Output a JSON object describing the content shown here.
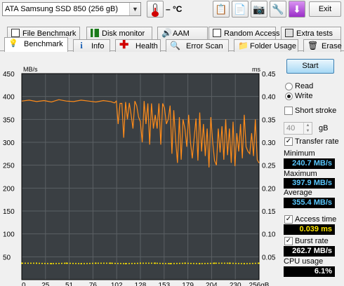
{
  "toolbar": {
    "drive_label": "ATA    Samsung SSD 850 (256 gB)",
    "temperature": "– °C",
    "exit_label": "Exit"
  },
  "tabs_row1": [
    {
      "label": "File Benchmark",
      "icon": "file-benchmark-icon"
    },
    {
      "label": "Disk monitor",
      "icon": "disk-monitor-icon"
    },
    {
      "label": "AAM",
      "icon": "speaker-icon"
    },
    {
      "label": "Random Access",
      "icon": "random-access-icon"
    },
    {
      "label": "Extra tests",
      "icon": "extra-tests-icon"
    }
  ],
  "tabs_row2": [
    {
      "label": "Benchmark",
      "icon": "benchmark-icon"
    },
    {
      "label": "Info",
      "icon": "info-icon"
    },
    {
      "label": "Health",
      "icon": "health-cross-icon"
    },
    {
      "label": "Error Scan",
      "icon": "error-scan-icon"
    },
    {
      "label": "Folder Usage",
      "icon": "folder-icon"
    },
    {
      "label": "Erase",
      "icon": "trash-icon"
    }
  ],
  "side": {
    "start_label": "Start",
    "read_label": "Read",
    "write_label": "Write",
    "short_stroke_label": "Short stroke",
    "short_stroke_value": "40",
    "short_stroke_unit": "gB",
    "transfer_rate_label": "Transfer rate",
    "minimum_label": "Minimum",
    "minimum_value": "240.7 MB/s",
    "maximum_label": "Maximum",
    "maximum_value": "397.9 MB/s",
    "average_label": "Average",
    "average_value": "355.4 MB/s",
    "access_time_label": "Access time",
    "access_time_value": "0.039 ms",
    "burst_rate_label": "Burst rate",
    "burst_rate_value": "262.7 MB/s",
    "cpu_usage_label": "CPU usage",
    "cpu_usage_value": "6.1%"
  },
  "chart_data": {
    "type": "line",
    "xlabel": "gB",
    "ylabel_left": "MB/s",
    "ylabel_right": "ms",
    "x_ticks": [
      "0",
      "25",
      "51",
      "76",
      "102",
      "128",
      "153",
      "179",
      "204",
      "230",
      "256gB"
    ],
    "y_left_ticks": [
      "450",
      "400",
      "350",
      "300",
      "250",
      "200",
      "150",
      "100",
      "50"
    ],
    "y_right_ticks": [
      "0.45",
      "0.40",
      "0.35",
      "0.30",
      "0.25",
      "0.20",
      "0.15",
      "0.10",
      "0.05"
    ],
    "xlim": [
      0,
      256
    ],
    "ylim_left": [
      0,
      450
    ],
    "ylim_right": [
      0,
      0.45
    ],
    "colors": {
      "transfer": "#ff8c1a",
      "access": "#ffe600",
      "background": "#3a3f43",
      "grid": "#5b6064"
    },
    "series": [
      {
        "name": "Transfer rate",
        "x": [
          0,
          8,
          16,
          24,
          32,
          40,
          48,
          56,
          64,
          72,
          80,
          88,
          96,
          100,
          102,
          104,
          106,
          108,
          110,
          112,
          114,
          116,
          118,
          120,
          122,
          124,
          126,
          128,
          130,
          132,
          134,
          136,
          138,
          140,
          142,
          144,
          146,
          148,
          150,
          152,
          154,
          156,
          158,
          160,
          162,
          164,
          166,
          168,
          170,
          172,
          174,
          176,
          178,
          180,
          182,
          184,
          186,
          188,
          190,
          192,
          194,
          196,
          198,
          200,
          202,
          204,
          206,
          208,
          210,
          212,
          214,
          216,
          218,
          220,
          222,
          224,
          226,
          228,
          230,
          232,
          234,
          236,
          238,
          240,
          242,
          244,
          246,
          248,
          250,
          252,
          254,
          256
        ],
        "y": [
          390,
          392,
          389,
          391,
          388,
          393,
          390,
          389,
          392,
          390,
          388,
          391,
          389,
          386,
          390,
          340,
          385,
          385,
          310,
          388,
          350,
          386,
          360,
          330,
          390,
          380,
          355,
          345,
          300,
          390,
          340,
          385,
          295,
          385,
          330,
          360,
          330,
          385,
          295,
          385,
          375,
          340,
          350,
          380,
          275,
          370,
          305,
          255,
          355,
          262,
          350,
          330,
          290,
          360,
          300,
          265,
          310,
          352,
          260,
          365,
          280,
          340,
          270,
          330,
          245,
          355,
          300,
          260,
          250,
          330,
          278,
          335,
          262,
          350,
          272,
          330,
          255,
          345,
          248,
          320,
          280,
          340,
          265,
          360,
          290,
          280,
          275,
          320,
          270,
          350,
          262,
          255
        ]
      },
      {
        "name": "Access time",
        "x": [
          0,
          16,
          32,
          48,
          64,
          80,
          96,
          112,
          128,
          144,
          160,
          176,
          192,
          208,
          224,
          240,
          256
        ],
        "y": [
          0.036,
          0.036,
          0.035,
          0.036,
          0.035,
          0.036,
          0.036,
          0.035,
          0.036,
          0.036,
          0.035,
          0.036,
          0.035,
          0.036,
          0.036,
          0.035,
          0.036
        ]
      }
    ]
  }
}
